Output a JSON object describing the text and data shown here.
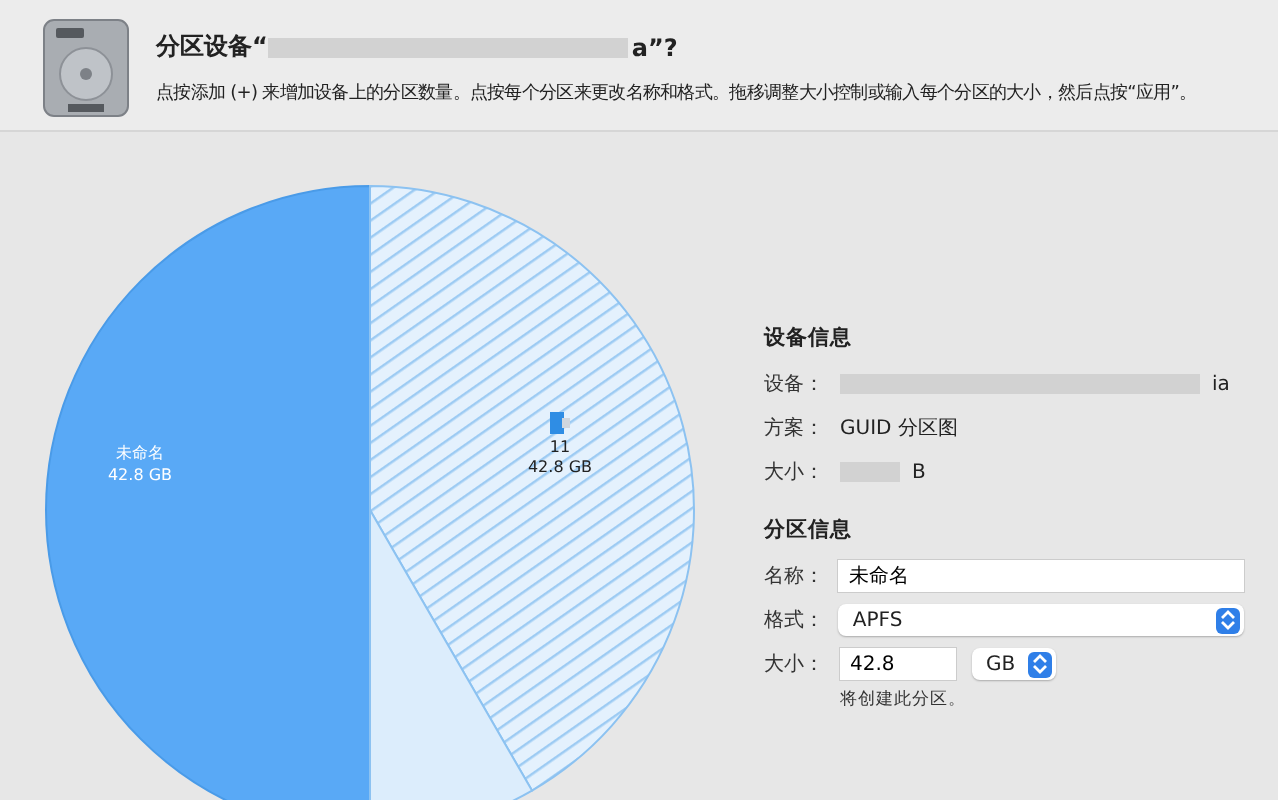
{
  "header": {
    "title_prefix": "分区设备“",
    "title_suffix": "a”?",
    "description": "点按添加 (+) 来增加设备上的分区数量。点按每个分区来更改名称和格式。拖移调整大小控制或输入每个分区的大小，然后点按“应用”。"
  },
  "pie": {
    "slices": [
      {
        "kind": "solid",
        "selected": true,
        "name": "未命名",
        "size": "42.8 GB"
      },
      {
        "kind": "hatched",
        "selected": false,
        "name": "11",
        "size": "42.8 GB"
      }
    ]
  },
  "device_info": {
    "heading": "设备信息",
    "rows": [
      {
        "label": "设备：",
        "value": "ia",
        "blurred": true
      },
      {
        "label": "方案：",
        "value": "GUID 分区图",
        "blurred": false
      },
      {
        "label": "大小：",
        "value": "B",
        "blurred": true
      }
    ]
  },
  "partition_info": {
    "heading": "分区信息",
    "name_label": "名称：",
    "name_value": "未命名",
    "format_label": "格式：",
    "format_value": "APFS",
    "size_label": "大小：",
    "size_value": "42.8",
    "unit_value": "GB",
    "note": "将创建此分区。"
  }
}
